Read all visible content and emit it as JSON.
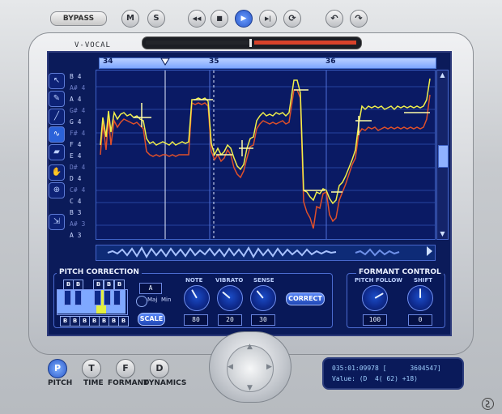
{
  "toolbar": {
    "bypass_label": "BYPASS",
    "m_label": "M",
    "s_label": "S",
    "rewind_icon": "◀◀",
    "stop_icon": "■",
    "play_icon": "▶",
    "skip_icon": "▶|",
    "loop_icon": "⟳",
    "undo_icon": "↶",
    "redo_icon": "↷"
  },
  "title": "V-VOCAL",
  "ruler": {
    "bars": [
      "34",
      "35",
      "36"
    ]
  },
  "note_labels": [
    {
      "text": "B 4",
      "dim": false
    },
    {
      "text": "A# 4",
      "dim": true
    },
    {
      "text": "A 4",
      "dim": false
    },
    {
      "text": "G# 4",
      "dim": true
    },
    {
      "text": "G 4",
      "dim": false
    },
    {
      "text": "F# 4",
      "dim": true
    },
    {
      "text": "F 4",
      "dim": false
    },
    {
      "text": "E 4",
      "dim": false
    },
    {
      "text": "D# 4",
      "dim": true
    },
    {
      "text": "D 4",
      "dim": false
    },
    {
      "text": "C# 4",
      "dim": true
    },
    {
      "text": "C 4",
      "dim": false
    },
    {
      "text": "B 3",
      "dim": false
    },
    {
      "text": "A# 3",
      "dim": true
    },
    {
      "text": "A 3",
      "dim": false
    }
  ],
  "pitch_correction": {
    "title": "PITCH CORRECTION",
    "key_value": "A",
    "maj_label": "Maj",
    "min_label": "Min",
    "scale_label": "SCALE",
    "top_key_marks": [
      "B",
      "B",
      "B",
      "B",
      "B"
    ],
    "bottom_key_marks": [
      "B",
      "B",
      "B",
      "B",
      "B",
      "B",
      "B"
    ],
    "note": {
      "label": "NOTE",
      "value": "80"
    },
    "vibrato": {
      "label": "VIBRATO",
      "value": "20"
    },
    "sense": {
      "label": "SENSE",
      "value": "30"
    },
    "correct_label": "CORRECT"
  },
  "formant_control": {
    "title": "FORMANT CONTROL",
    "pitch_follow": {
      "label": "PITCH FOLLOW",
      "value": "100"
    },
    "shift": {
      "label": "SHIFT",
      "value": "0"
    }
  },
  "modes": [
    {
      "key": "P",
      "label": "PITCH",
      "active": true
    },
    {
      "key": "T",
      "label": "TIME",
      "active": false
    },
    {
      "key": "F",
      "label": "FORMANT",
      "active": false
    },
    {
      "key": "D",
      "label": "DYNAMICS",
      "active": false
    }
  ],
  "display": {
    "line1": "035:01:09978 [      3604547]",
    "line2": "Value: (D  4( 62) +18)"
  },
  "colors": {
    "screen_bg": "#0b1b5a",
    "corrected_pitch": "#f2f04a",
    "original_pitch": "#e0502a",
    "accent": "#2a58c8"
  },
  "icons": {
    "tools": [
      "arrow-icon",
      "pencil-icon",
      "line-icon",
      "vibrato-icon",
      "eraser-icon",
      "hand-icon",
      "zoom-icon",
      "fit-icon"
    ]
  }
}
